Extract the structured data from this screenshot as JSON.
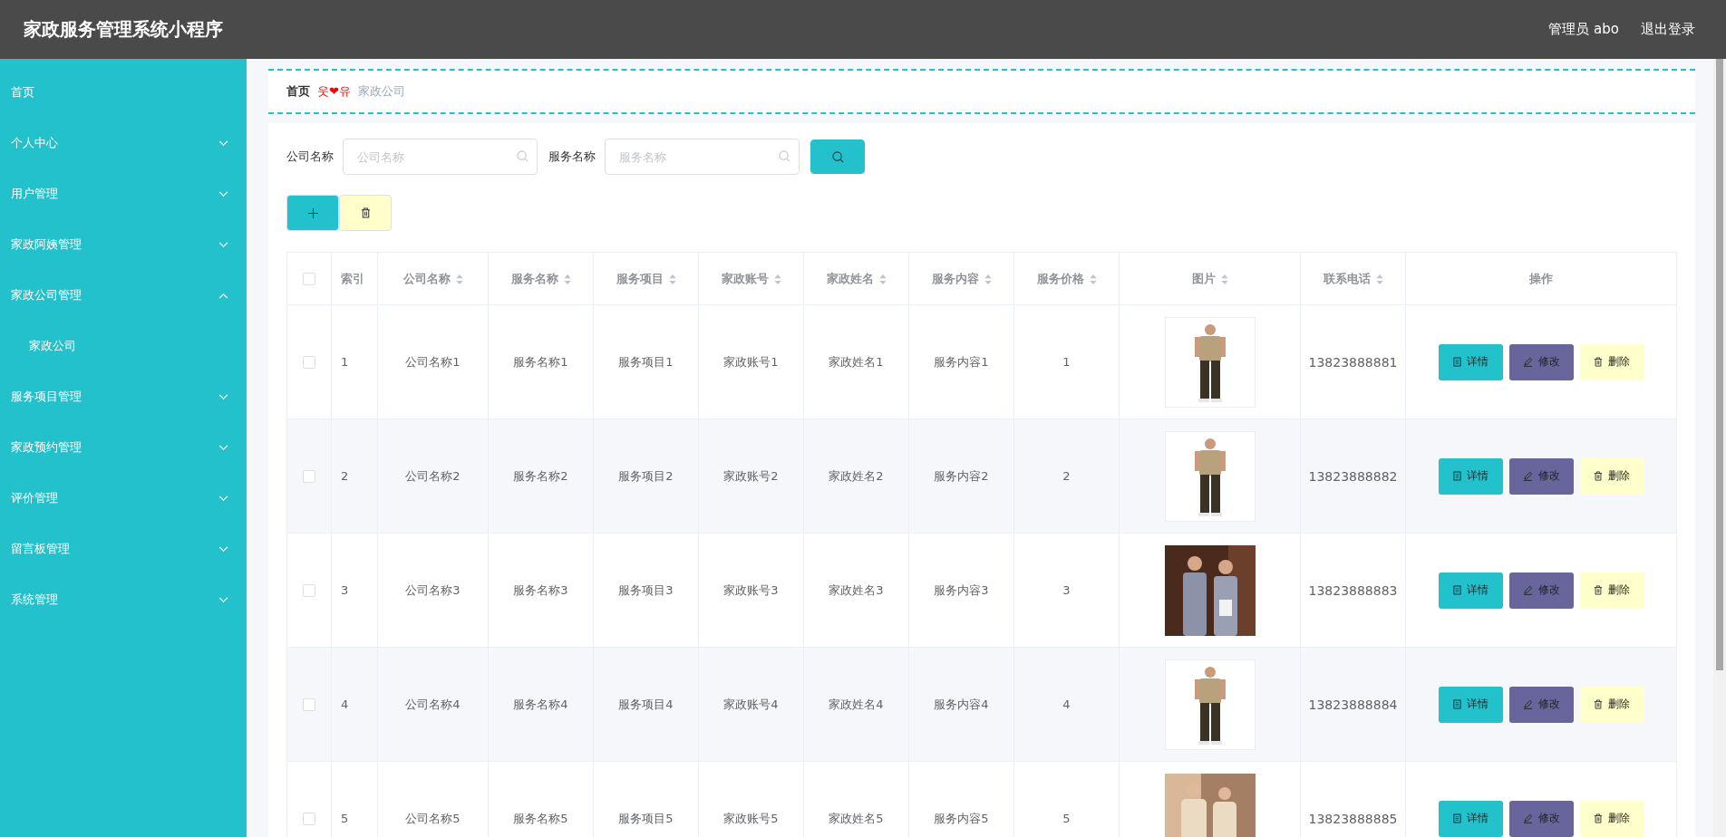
{
  "header": {
    "title": "家政服务管理系统小程序",
    "user": "管理员 abo",
    "logout": "退出登录"
  },
  "sidebar": {
    "items": [
      {
        "label": "首页"
      },
      {
        "label": "个人中心",
        "expanded": false
      },
      {
        "label": "用户管理",
        "expanded": false
      },
      {
        "label": "家政阿姨管理",
        "expanded": false
      },
      {
        "label": "家政公司管理",
        "expanded": true,
        "children": [
          {
            "label": "家政公司"
          }
        ]
      },
      {
        "label": "服务项目管理",
        "expanded": false
      },
      {
        "label": "家政预约管理",
        "expanded": false
      },
      {
        "label": "评价管理",
        "expanded": false
      },
      {
        "label": "留言板管理",
        "expanded": false
      },
      {
        "label": "系统管理",
        "expanded": false
      }
    ]
  },
  "breadcrumb": {
    "home": "首页",
    "separator": "웃❤유",
    "current": "家政公司"
  },
  "search": {
    "fields": [
      {
        "label": "公司名称",
        "placeholder": "公司名称"
      },
      {
        "label": "服务名称",
        "placeholder": "服务名称"
      }
    ]
  },
  "table": {
    "header_checked": false,
    "columns": [
      {
        "label": "索引",
        "sortable": false
      },
      {
        "label": "公司名称",
        "sortable": true
      },
      {
        "label": "服务名称",
        "sortable": true
      },
      {
        "label": "服务项目",
        "sortable": true
      },
      {
        "label": "家政账号",
        "sortable": true
      },
      {
        "label": "家政姓名",
        "sortable": true
      },
      {
        "label": "服务内容",
        "sortable": true
      },
      {
        "label": "服务价格",
        "sortable": true
      },
      {
        "label": "图片",
        "sortable": true
      },
      {
        "label": "联系电话",
        "sortable": true
      },
      {
        "label": "操作",
        "sortable": false
      }
    ],
    "rows": [
      {
        "checked": false,
        "cells": [
          "1",
          "公司名称1",
          "服务名称1",
          "服务项目1",
          "家政账号1",
          "家政姓名1",
          "服务内容1",
          "1"
        ],
        "phone": "13823888881",
        "actions": [
          {
            "kind": "detail",
            "label": "详情"
          },
          {
            "kind": "edit",
            "label": "修改"
          },
          {
            "kind": "delete",
            "label": "删除"
          }
        ]
      },
      {
        "checked": false,
        "cells": [
          "2",
          "公司名称2",
          "服务名称2",
          "服务项目2",
          "家政账号2",
          "家政姓名2",
          "服务内容2",
          "2"
        ],
        "phone": "13823888882",
        "actions": [
          {
            "kind": "detail",
            "label": "详情"
          },
          {
            "kind": "edit",
            "label": "修改"
          },
          {
            "kind": "delete",
            "label": "删除"
          }
        ]
      },
      {
        "checked": false,
        "cells": [
          "3",
          "公司名称3",
          "服务名称3",
          "服务项目3",
          "家政账号3",
          "家政姓名3",
          "服务内容3",
          "3"
        ],
        "phone": "13823888883",
        "actions": [
          {
            "kind": "detail",
            "label": "详情"
          },
          {
            "kind": "edit",
            "label": "修改"
          },
          {
            "kind": "delete",
            "label": "删除"
          }
        ]
      },
      {
        "checked": false,
        "cells": [
          "4",
          "公司名称4",
          "服务名称4",
          "服务项目4",
          "家政账号4",
          "家政姓名4",
          "服务内容4",
          "4"
        ],
        "phone": "13823888884",
        "actions": [
          {
            "kind": "detail",
            "label": "详情"
          },
          {
            "kind": "edit",
            "label": "修改"
          },
          {
            "kind": "delete",
            "label": "删除"
          }
        ]
      },
      {
        "checked": false,
        "cells": [
          "5",
          "公司名称5",
          "服务名称5",
          "服务项目5",
          "家政账号5",
          "家政姓名5",
          "服务内容5",
          "5"
        ],
        "phone": "13823888885",
        "actions": [
          {
            "kind": "detail",
            "label": "详情"
          },
          {
            "kind": "edit",
            "label": "修改"
          },
          {
            "kind": "delete",
            "label": "删除"
          }
        ]
      }
    ]
  }
}
